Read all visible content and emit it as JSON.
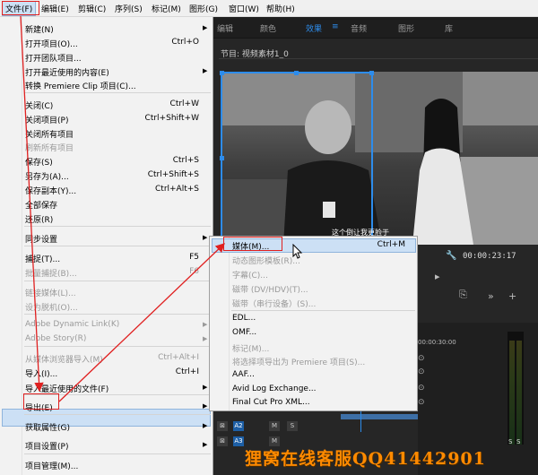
{
  "menubar": {
    "items": [
      "文件(F)",
      "编辑(E)",
      "剪辑(C)",
      "序列(S)",
      "标记(M)",
      "图形(G)",
      "窗口(W)",
      "帮助(H)"
    ]
  },
  "panel_tabs": {
    "edit": "编辑",
    "color": "颜色",
    "effects": "效果",
    "audio": "音频",
    "graphics": "图形",
    "library": "库"
  },
  "program_monitor": {
    "title": "节目: 视频素材1_0",
    "subtitle": "这个倒让我更脸于",
    "timecode": "00:00:23:17"
  },
  "timeline": {
    "ruler": "00:00:30:00",
    "track_a2": "A2",
    "track_a3": "A3",
    "track_m": "M",
    "track_s": "S",
    "meter_labels": [
      "S",
      "S"
    ]
  },
  "file_menu": {
    "items": [
      {
        "label": "新建(N)",
        "shortcut": "",
        "submenu": true,
        "disabled": false
      },
      {
        "label": "打开项目(O)...",
        "shortcut": "Ctrl+O",
        "submenu": false,
        "disabled": false
      },
      {
        "label": "打开团队项目...",
        "shortcut": "",
        "submenu": false,
        "disabled": false
      },
      {
        "label": "打开最近使用的内容(E)",
        "shortcut": "",
        "submenu": true,
        "disabled": false
      },
      {
        "label": "转换 Premiere Clip 项目(C)...",
        "shortcut": "",
        "submenu": false,
        "disabled": false
      },
      {
        "label": "关闭(C)",
        "shortcut": "Ctrl+W",
        "submenu": false,
        "disabled": false
      },
      {
        "label": "关闭项目(P)",
        "shortcut": "Ctrl+Shift+W",
        "submenu": false,
        "disabled": false
      },
      {
        "label": "关闭所有项目",
        "shortcut": "",
        "submenu": false,
        "disabled": false
      },
      {
        "label": "刷新所有项目",
        "shortcut": "",
        "submenu": false,
        "disabled": true
      },
      {
        "label": "保存(S)",
        "shortcut": "Ctrl+S",
        "submenu": false,
        "disabled": false
      },
      {
        "label": "另存为(A)...",
        "shortcut": "Ctrl+Shift+S",
        "submenu": false,
        "disabled": false
      },
      {
        "label": "保存副本(Y)...",
        "shortcut": "Ctrl+Alt+S",
        "submenu": false,
        "disabled": false
      },
      {
        "label": "全部保存",
        "shortcut": "",
        "submenu": false,
        "disabled": false
      },
      {
        "label": "还原(R)",
        "shortcut": "",
        "submenu": false,
        "disabled": false
      },
      {
        "label": "同步设置",
        "shortcut": "",
        "submenu": true,
        "disabled": false
      },
      {
        "label": "捕捉(T)...",
        "shortcut": "F5",
        "submenu": false,
        "disabled": false
      },
      {
        "label": "批量捕捉(B)...",
        "shortcut": "F6",
        "submenu": false,
        "disabled": true
      },
      {
        "label": "链接媒体(L)...",
        "shortcut": "",
        "submenu": false,
        "disabled": true
      },
      {
        "label": "设为脱机(O)...",
        "shortcut": "",
        "submenu": false,
        "disabled": true
      },
      {
        "label": "Adobe Dynamic Link(K)",
        "shortcut": "",
        "submenu": true,
        "disabled": true
      },
      {
        "label": "Adobe Story(R)",
        "shortcut": "",
        "submenu": true,
        "disabled": true
      },
      {
        "label": "从媒体浏览器导入(M)",
        "shortcut": "Ctrl+Alt+I",
        "submenu": false,
        "disabled": true
      },
      {
        "label": "导入(I)...",
        "shortcut": "Ctrl+I",
        "submenu": false,
        "disabled": false
      },
      {
        "label": "导入最近使用的文件(F)",
        "shortcut": "",
        "submenu": true,
        "disabled": false
      },
      {
        "label": "导出(E)",
        "shortcut": "",
        "submenu": true,
        "disabled": false
      },
      {
        "label": "获取属性(G)",
        "shortcut": "",
        "submenu": true,
        "disabled": false
      },
      {
        "label": "项目设置(P)",
        "shortcut": "",
        "submenu": true,
        "disabled": false
      },
      {
        "label": "项目管理(M)...",
        "shortcut": "",
        "submenu": false,
        "disabled": false
      }
    ]
  },
  "export_submenu": {
    "items": [
      {
        "label": "媒体(M)...",
        "shortcut": "Ctrl+M",
        "disabled": false
      },
      {
        "label": "动态图形模板(R)...",
        "shortcut": "",
        "disabled": true
      },
      {
        "label": "字幕(C)...",
        "shortcut": "",
        "disabled": true
      },
      {
        "label": "磁带 (DV/HDV)(T)...",
        "shortcut": "",
        "disabled": true
      },
      {
        "label": "磁带（串行设备）(S)...",
        "shortcut": "",
        "disabled": true
      },
      {
        "label": "EDL...",
        "shortcut": "",
        "disabled": false
      },
      {
        "label": "OMF...",
        "shortcut": "",
        "disabled": false
      },
      {
        "label": "标记(M)...",
        "shortcut": "",
        "disabled": true
      },
      {
        "label": "将选择项导出为 Premiere 项目(S)...",
        "shortcut": "",
        "disabled": true
      },
      {
        "label": "AAF...",
        "shortcut": "",
        "disabled": false
      },
      {
        "label": "Avid Log Exchange...",
        "shortcut": "",
        "disabled": false
      },
      {
        "label": "Final Cut Pro XML...",
        "shortcut": "",
        "disabled": false
      }
    ]
  },
  "watermark": {
    "text": "狸窝在线客服QQ41442901"
  },
  "colors": {
    "accent": "#2d8ceb",
    "annotation": "#e02020",
    "highlight": "#cce0f5",
    "watermark": "#ff8a00"
  }
}
